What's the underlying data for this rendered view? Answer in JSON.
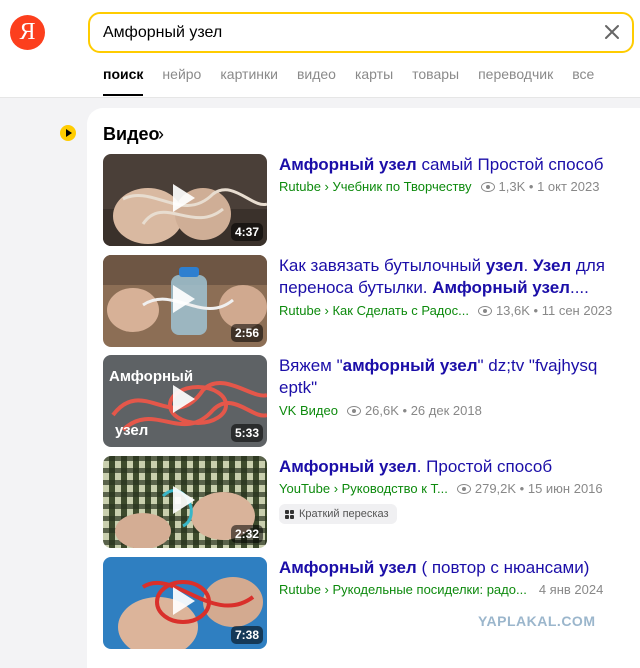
{
  "header": {
    "logo": "Я",
    "search_value": "Амфорный узел",
    "tabs": [
      "поиск",
      "нейро",
      "картинки",
      "видео",
      "карты",
      "товары",
      "переводчик",
      "все"
    ]
  },
  "section": {
    "title": "Видео",
    "chevron": "›"
  },
  "videos": [
    {
      "title_bold": "Амфорный узел",
      "title_rest": " самый Простой способ",
      "source": "Rutube › Учебник по Творчеству",
      "views": "1,3K",
      "date": "1 окт 2023",
      "duration": "4:37"
    },
    {
      "title_pre": "Как завязать бутылочный ",
      "title_b1": "узел",
      "title_mid": ". ",
      "title_b2": "Узел",
      "title_mid2": " для переноса бутылки. ",
      "title_b3": "Амфорный узел",
      "title_end": "....",
      "source": "Rutube › Как Сделать с Радос...",
      "views": "13,6K",
      "date": "11 сен 2023",
      "duration": "2:56"
    },
    {
      "title_pre": "Вяжем \"",
      "title_bold": "амфорный узел",
      "title_rest": "\" dz;tv \"fvajhysq eptk\"",
      "source": "VK Видео",
      "views": "26,6K",
      "date": "26 дек 2018",
      "duration": "5:33",
      "thumb_text_top": "Амфорный",
      "thumb_text_bottom": "узел"
    },
    {
      "title_bold": "Амфорный узел",
      "title_rest": ". Простой способ",
      "source": "YouTube › Руководство к Т...",
      "views": "279,2K",
      "date": "15 июн 2016",
      "duration": "2:32",
      "chip": "Краткий пересказ"
    },
    {
      "title_bold": "Амфорный узел",
      "title_rest": " ( повтор с нюансами)",
      "source": "Rutube › Рукодельные посиделки: радо...",
      "date": "4 янв 2024",
      "duration": "7:38"
    }
  ],
  "watermark": "YAPLAKAL.COM",
  "colors": {
    "accent": "#ffcc00",
    "logo": "#fc3f1d",
    "link": "#1b0ea8",
    "source": "#0d8a0d"
  }
}
